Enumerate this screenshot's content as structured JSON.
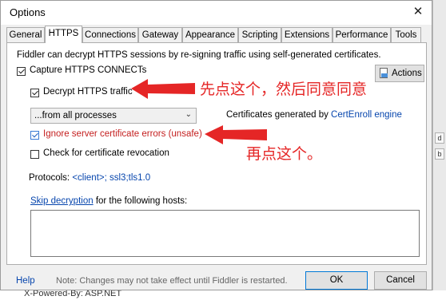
{
  "window": {
    "title": "Options",
    "close_glyph": "✕"
  },
  "tabs": [
    {
      "label": "General",
      "active": false
    },
    {
      "label": "HTTPS",
      "active": true
    },
    {
      "label": "Connections",
      "active": false
    },
    {
      "label": "Gateway",
      "active": false
    },
    {
      "label": "Appearance",
      "active": false
    },
    {
      "label": "Scripting",
      "active": false
    },
    {
      "label": "Extensions",
      "active": false
    },
    {
      "label": "Performance",
      "active": false
    },
    {
      "label": "Tools",
      "active": false
    }
  ],
  "https": {
    "intro": "Fiddler can decrypt HTTPS sessions by re-signing traffic using self-generated certificates.",
    "capture_label": "Capture HTTPS CONNECTs",
    "capture_checked": true,
    "actions_label": "Actions",
    "decrypt_label": "Decrypt HTTPS traffic",
    "decrypt_checked": true,
    "process_select_value": "...from all processes",
    "cert_prefix": "Certificates generated by ",
    "cert_engine": "CertEnroll engine",
    "ignore_label": "Ignore server certificate errors (unsafe)",
    "ignore_checked": true,
    "revocation_label": "Check for certificate revocation",
    "revocation_checked": false,
    "protocols_prefix": "Protocols: ",
    "protocols_value": "<client>; ssl3;tls1.0",
    "skip_link": "Skip decryption",
    "skip_suffix": " for the following hosts:",
    "hosts_value": ""
  },
  "footer": {
    "help": "Help",
    "note": "Note: Changes may not take effect until Fiddler is restarted.",
    "ok": "OK",
    "cancel": "Cancel"
  },
  "annotations": {
    "first": "先点这个，然后同意同意",
    "second": "再点这个。",
    "color": "#e52626"
  },
  "background": {
    "bottom_text": "X-Powered-By: ASP.NET",
    "strip_marks": [
      "d",
      "b"
    ]
  }
}
